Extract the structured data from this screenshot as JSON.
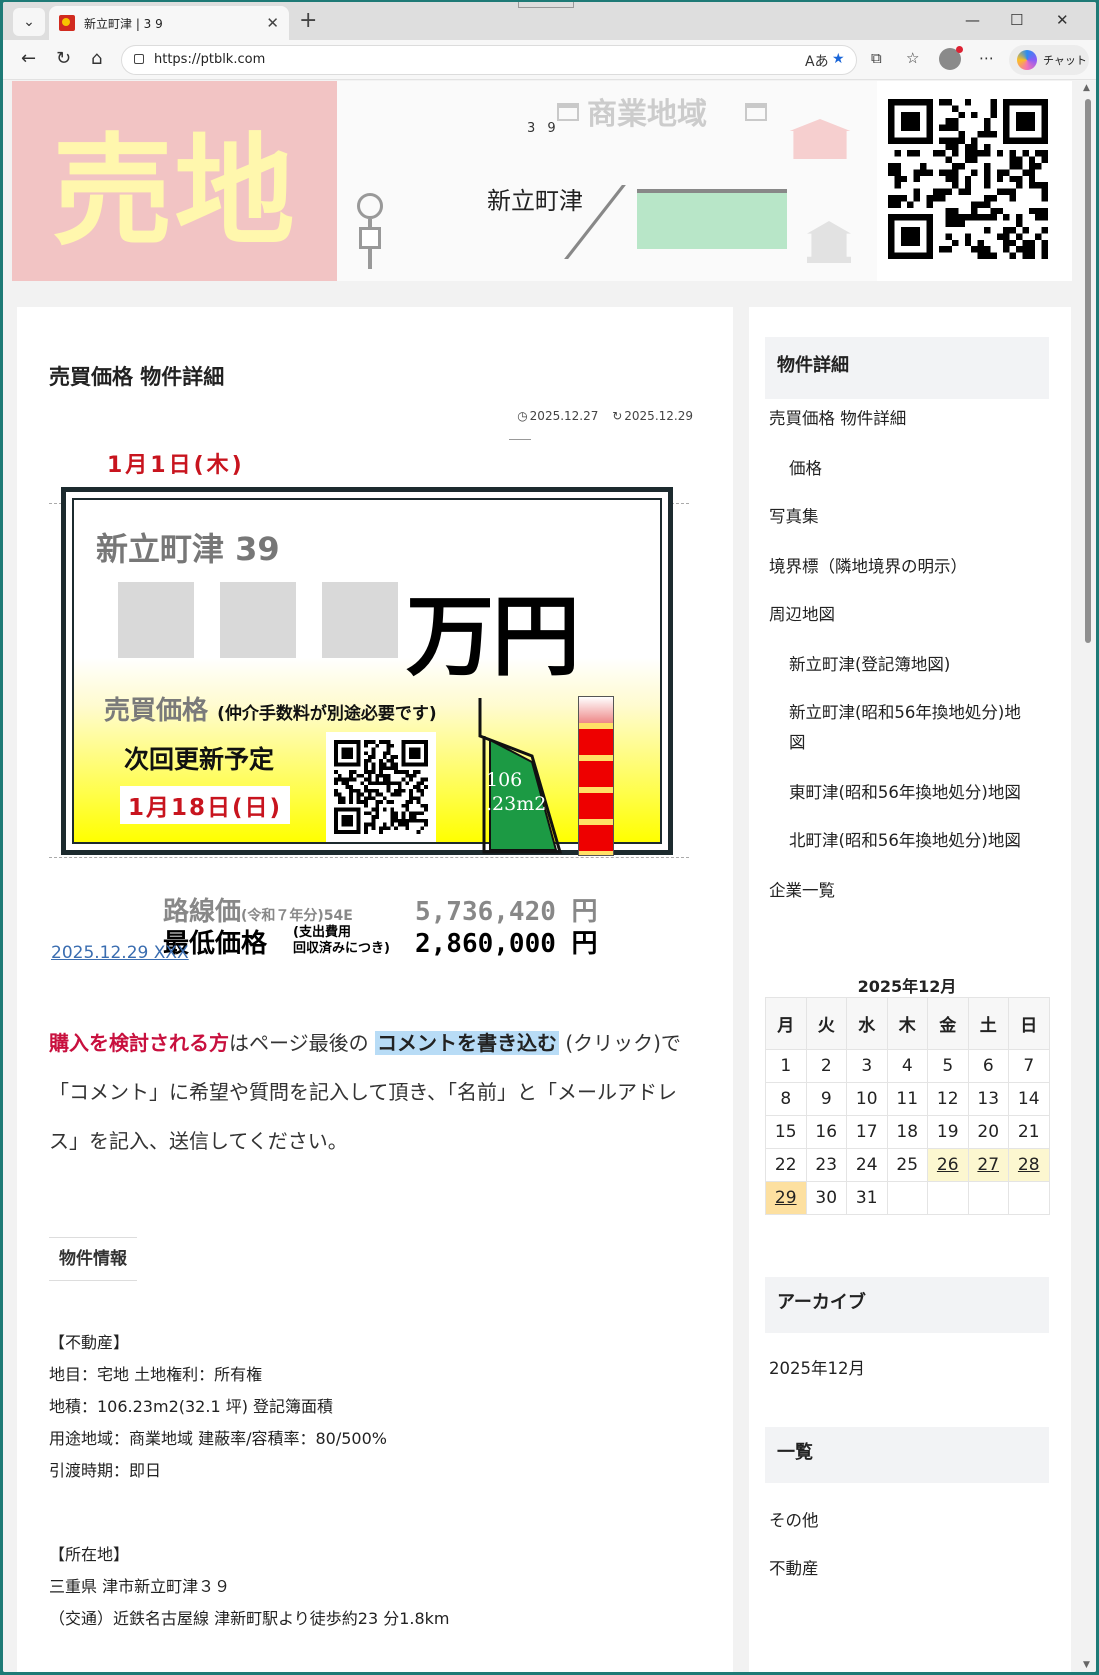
{
  "browser": {
    "tab_title": "新立町津 | 3 9",
    "url": "https://ptblk.com",
    "copilot_label": "チャット"
  },
  "header": {
    "sale_text": "売地",
    "zone_label": "商業地域",
    "lot_number": "3 9",
    "town_name": "新立町津"
  },
  "post": {
    "title": "売買価格 物件詳細",
    "posted": "2025.12.27",
    "updated": "2025.12.29",
    "link_text": "2025.12.29 XXX"
  },
  "flyer": {
    "date_top": "1月1日(木)",
    "town": "新立町津 39",
    "price_unit": "万円",
    "sale_price_label": "売買価格",
    "sale_price_note": "(仲介手数料が別途必要です)",
    "next_update_label": "次回更新予定",
    "next_update_date": "1月18日(日)",
    "area_line1": "106",
    "area_line2": ".23m2",
    "road_price_label": "路線価",
    "road_price_note": "(令和７年分)54E",
    "road_price_value": "5,736,420 円",
    "min_price_label": "最低価格",
    "min_price_note1": "(支出費用",
    "min_price_note2": "回収済みにつき)",
    "min_price_value": "2,860,000 円"
  },
  "intro": {
    "lead_red": "購入を検討される方",
    "text1": "はページ最後の ",
    "highlight": "コメントを書き込む",
    "text2": " (クリック)で「コメント」に希望や質問を記入して頂き、「名前」と「メールアドレス」を記入、送信してください。"
  },
  "property": {
    "section_label": "物件情報",
    "lines": [
      "【不動産】",
      "地目：宅地 土地権利：所有権",
      "地積：106.23m2(32.1 坪) 登記簿面積",
      "用途地域：商業地域 建蔽率/容積率：80/500%",
      "引渡時期：即日"
    ],
    "location_lines": [
      "【所在地】",
      "三重県 津市新立町津３９",
      "（交通）近鉄名古屋線 津新町駅より徒歩約23 分1.8km"
    ]
  },
  "sidebar": {
    "toc_title": "物件詳細",
    "toc": [
      {
        "label": "売買価格 物件詳細",
        "indent": false
      },
      {
        "label": "価格",
        "indent": true
      },
      {
        "label": "写真集",
        "indent": false
      },
      {
        "label": "境界標（隣地境界の明示）",
        "indent": false
      },
      {
        "label": "周辺地図",
        "indent": false
      },
      {
        "label": "新立町津(登記簿地図)",
        "indent": true
      },
      {
        "label": "新立町津(昭和56年換地処分)地",
        "indent": true
      },
      {
        "label": "図",
        "indent": true
      },
      {
        "label": "東町津(昭和56年換地処分)地図",
        "indent": true
      },
      {
        "label": "北町津(昭和56年換地処分)地図",
        "indent": true
      },
      {
        "label": "企業一覧",
        "indent": false
      }
    ],
    "calendar_title": "2025年12月",
    "weekdays": [
      "月",
      "火",
      "水",
      "木",
      "金",
      "土",
      "日"
    ],
    "weeks": [
      [
        "1",
        "2",
        "3",
        "4",
        "5",
        "6",
        "7"
      ],
      [
        "8",
        "9",
        "10",
        "11",
        "12",
        "13",
        "14"
      ],
      [
        "15",
        "16",
        "17",
        "18",
        "19",
        "20",
        "21"
      ],
      [
        "22",
        "23",
        "24",
        "25",
        "26",
        "27",
        "28"
      ],
      [
        "29",
        "30",
        "31",
        "",
        "",
        "",
        ""
      ]
    ],
    "linked_days": [
      "26",
      "27",
      "28"
    ],
    "today": "29",
    "archive_title": "アーカイブ",
    "archive_item": "2025年12月",
    "list_title": "一覧",
    "list_items": [
      "その他",
      "不動産"
    ]
  }
}
